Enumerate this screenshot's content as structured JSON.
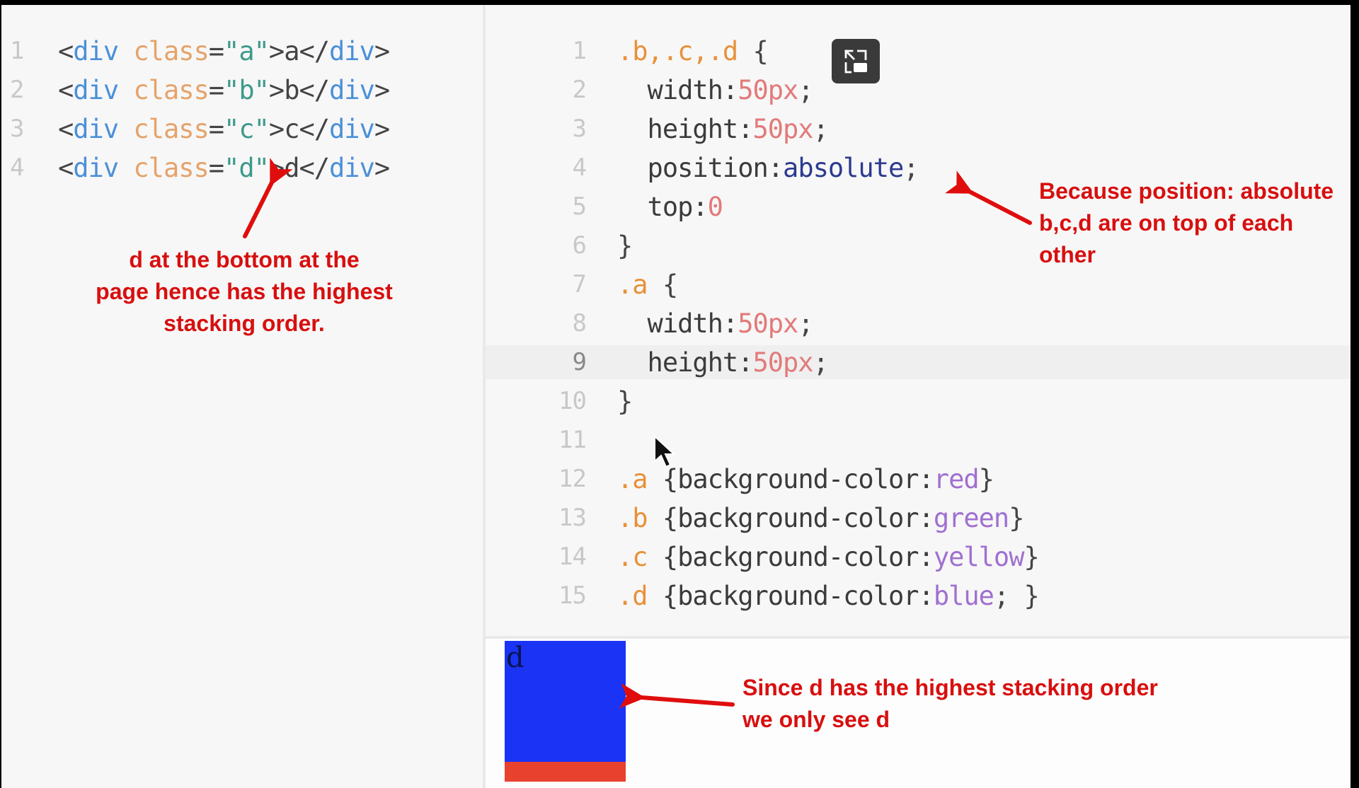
{
  "html_editor": {
    "lines": [
      {
        "num": "1",
        "open_lt": "<",
        "tag": "div",
        "attr": "class",
        "eq": "=",
        "q1": "\"",
        "val": "a",
        "q2": "\"",
        "gt": ">",
        "text": "a",
        "close_lt": "</",
        "close_tag": "div",
        "close_gt": ">"
      },
      {
        "num": "2",
        "open_lt": "<",
        "tag": "div",
        "attr": "class",
        "eq": "=",
        "q1": "\"",
        "val": "b",
        "q2": "\"",
        "gt": ">",
        "text": "b",
        "close_lt": "</",
        "close_tag": "div",
        "close_gt": ">"
      },
      {
        "num": "3",
        "open_lt": "<",
        "tag": "div",
        "attr": "class",
        "eq": "=",
        "q1": "\"",
        "val": "c",
        "q2": "\"",
        "gt": ">",
        "text": "c",
        "close_lt": "</",
        "close_tag": "div",
        "close_gt": ">"
      },
      {
        "num": "4",
        "open_lt": "<",
        "tag": "div",
        "attr": "class",
        "eq": "=",
        "q1": "\"",
        "val": "d",
        "q2": "\"",
        "gt": ">",
        "text": "d",
        "close_lt": "</",
        "close_tag": "div",
        "close_gt": ">"
      }
    ]
  },
  "css_editor": {
    "highlighted_line": "9",
    "lines": [
      {
        "num": "1",
        "sel": ".b,.c,.d",
        "rest": " {"
      },
      {
        "num": "2",
        "prop": "  width:",
        "val": "50px",
        "end": ";"
      },
      {
        "num": "3",
        "prop": "  height:",
        "val": "50px",
        "end": ";"
      },
      {
        "num": "4",
        "prop": "  position:",
        "kw": "absolute",
        "end": ";"
      },
      {
        "num": "5",
        "prop": "  top:",
        "val": "0",
        "end": ""
      },
      {
        "num": "6",
        "brace": "}"
      },
      {
        "num": "7",
        "sel": ".a",
        "rest": " {"
      },
      {
        "num": "8",
        "prop": "  width:",
        "val": "50px",
        "end": ";"
      },
      {
        "num": "9",
        "prop": "  height:",
        "val": "50px",
        "end": ";"
      },
      {
        "num": "10",
        "brace": "}"
      },
      {
        "num": "11"
      },
      {
        "num": "12",
        "sel": ".a",
        "mid": " {background-color:",
        "color": "red",
        "end": "}"
      },
      {
        "num": "13",
        "sel": ".b",
        "mid": " {background-color:",
        "color": "green",
        "end": "}"
      },
      {
        "num": "14",
        "sel": ".c",
        "mid": " {background-color:",
        "color": "yellow",
        "end": "}"
      },
      {
        "num": "15",
        "sel": ".d",
        "mid": " {background-color:",
        "color": "blue",
        "end": "; }"
      }
    ],
    "toggle_icon": "picture-in-picture-exit-icon"
  },
  "output": {
    "visible_box_label": "d",
    "visible_box_color": "#1a33f5",
    "underlying_box_color": "#e8412e"
  },
  "annotations": {
    "color": "#d80f0f",
    "left": [
      "d at the bottom at the",
      "page hence has the highest",
      "stacking order."
    ],
    "right": [
      "Because position: absolute",
      "b,c,d are on top of each",
      "other"
    ],
    "bottom": [
      "Since d has the highest stacking order",
      "we only see d"
    ]
  }
}
